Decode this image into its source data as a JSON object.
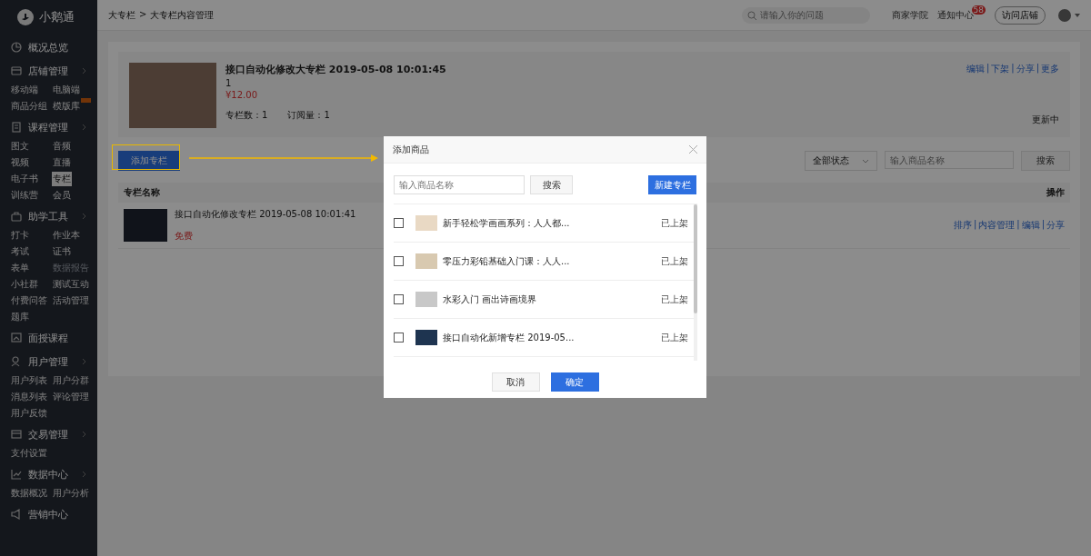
{
  "logo": {
    "text": "小鹅通"
  },
  "sidebar": {
    "groups": [
      {
        "label": "概况总览",
        "kind": "overview"
      },
      {
        "label": "店铺管理",
        "kind": "store",
        "items": [
          {
            "label": "移动端",
            "selected": false,
            "disabled": false
          },
          {
            "label": "电脑端",
            "selected": false,
            "disabled": false
          },
          {
            "label": "商品分组",
            "selected": false,
            "disabled": false
          },
          {
            "label": "模版库",
            "selected": false,
            "disabled": false,
            "badge": true
          }
        ]
      },
      {
        "label": "课程管理",
        "kind": "course",
        "items": [
          {
            "label": "图文",
            "selected": false,
            "disabled": false
          },
          {
            "label": "音频",
            "selected": false,
            "disabled": false
          },
          {
            "label": "视频",
            "selected": false,
            "disabled": false
          },
          {
            "label": "直播",
            "selected": false,
            "disabled": false
          },
          {
            "label": "电子书",
            "selected": false,
            "disabled": false
          },
          {
            "label": "专栏",
            "selected": true,
            "disabled": false
          },
          {
            "label": "训练营",
            "selected": false,
            "disabled": false
          },
          {
            "label": "会员",
            "selected": false,
            "disabled": false
          }
        ]
      },
      {
        "label": "助学工具",
        "kind": "tools",
        "items": [
          {
            "label": "打卡",
            "selected": false,
            "disabled": false
          },
          {
            "label": "作业本",
            "selected": false,
            "disabled": false
          },
          {
            "label": "考试",
            "selected": false,
            "disabled": false
          },
          {
            "label": "证书",
            "selected": false,
            "disabled": false
          },
          {
            "label": "表单",
            "selected": false,
            "disabled": false
          },
          {
            "label": "数据报告",
            "selected": false,
            "disabled": true
          },
          {
            "label": "小社群",
            "selected": false,
            "disabled": false
          },
          {
            "label": "测试互动",
            "selected": false,
            "disabled": false
          },
          {
            "label": "付费问答",
            "selected": false,
            "disabled": false
          },
          {
            "label": "活动管理",
            "selected": false,
            "disabled": false
          },
          {
            "label": "题库",
            "selected": false,
            "disabled": false
          }
        ]
      },
      {
        "label": "面授课程",
        "kind": "offline"
      },
      {
        "label": "用户管理",
        "kind": "users",
        "items": [
          {
            "label": "用户列表",
            "selected": false,
            "disabled": false
          },
          {
            "label": "用户分群",
            "selected": false,
            "disabled": false
          },
          {
            "label": "消息列表",
            "selected": false,
            "disabled": false
          },
          {
            "label": "评论管理",
            "selected": false,
            "disabled": false
          },
          {
            "label": "用户反馈",
            "selected": false,
            "disabled": false
          }
        ]
      },
      {
        "label": "交易管理",
        "kind": "trade",
        "items": [
          {
            "label": "支付设置",
            "selected": false,
            "disabled": false
          }
        ]
      },
      {
        "label": "数据中心",
        "kind": "data",
        "items": [
          {
            "label": "数据概况",
            "selected": false,
            "disabled": false
          },
          {
            "label": "用户分析",
            "selected": false,
            "disabled": false
          }
        ]
      },
      {
        "label": "营销中心",
        "kind": "marketing"
      }
    ]
  },
  "topbar": {
    "breadcrumb": [
      "大专栏",
      "大专栏内容管理"
    ],
    "separator": ">",
    "search": {
      "placeholder": "请输入你的问题"
    },
    "links": [
      "商家学院",
      "通知中心"
    ],
    "notification_count": "58",
    "visit_button": "访问店铺"
  },
  "column_header": {
    "title": "接口自动化修改大专栏 2019-05-08 10:01:45",
    "line_2": "1",
    "price": "¥12.00",
    "column_count": "专栏数：1",
    "subscriptions": "订阅量：1",
    "actions": [
      "编辑",
      "下架",
      "分享",
      "更多"
    ],
    "action_separator": "|",
    "status": "更新中"
  },
  "add_button": "添加专栏",
  "filter": {
    "status": "全部状态",
    "placeholder": "输入商品名称",
    "search_button": "搜索"
  },
  "table": {
    "columns": [
      "专栏名称",
      "操作"
    ],
    "rows": [
      {
        "title": "接口自动化修改专栏 2019-05-08 10:01:41",
        "price": "免费",
        "actions": [
          "排序",
          "内容管理",
          "编辑",
          "分享"
        ],
        "action_separator": "|"
      }
    ]
  },
  "dialog": {
    "title": "添加商品",
    "search": {
      "placeholder": "输入商品名称"
    },
    "search_button": "搜索",
    "new_button": "新建专栏",
    "items": [
      {
        "title": "新手轻松学画画系列：人人都...",
        "status": "已上架",
        "checked": false
      },
      {
        "title": "零压力彩铅基础入门课：人人...",
        "status": "已上架",
        "checked": false
      },
      {
        "title": "水彩入门 画出诗画境界",
        "status": "已上架",
        "checked": false
      },
      {
        "title": "接口自动化新增专栏 2019-05...",
        "status": "已上架",
        "checked": false
      }
    ],
    "cancel": "取消",
    "confirm": "确定"
  }
}
